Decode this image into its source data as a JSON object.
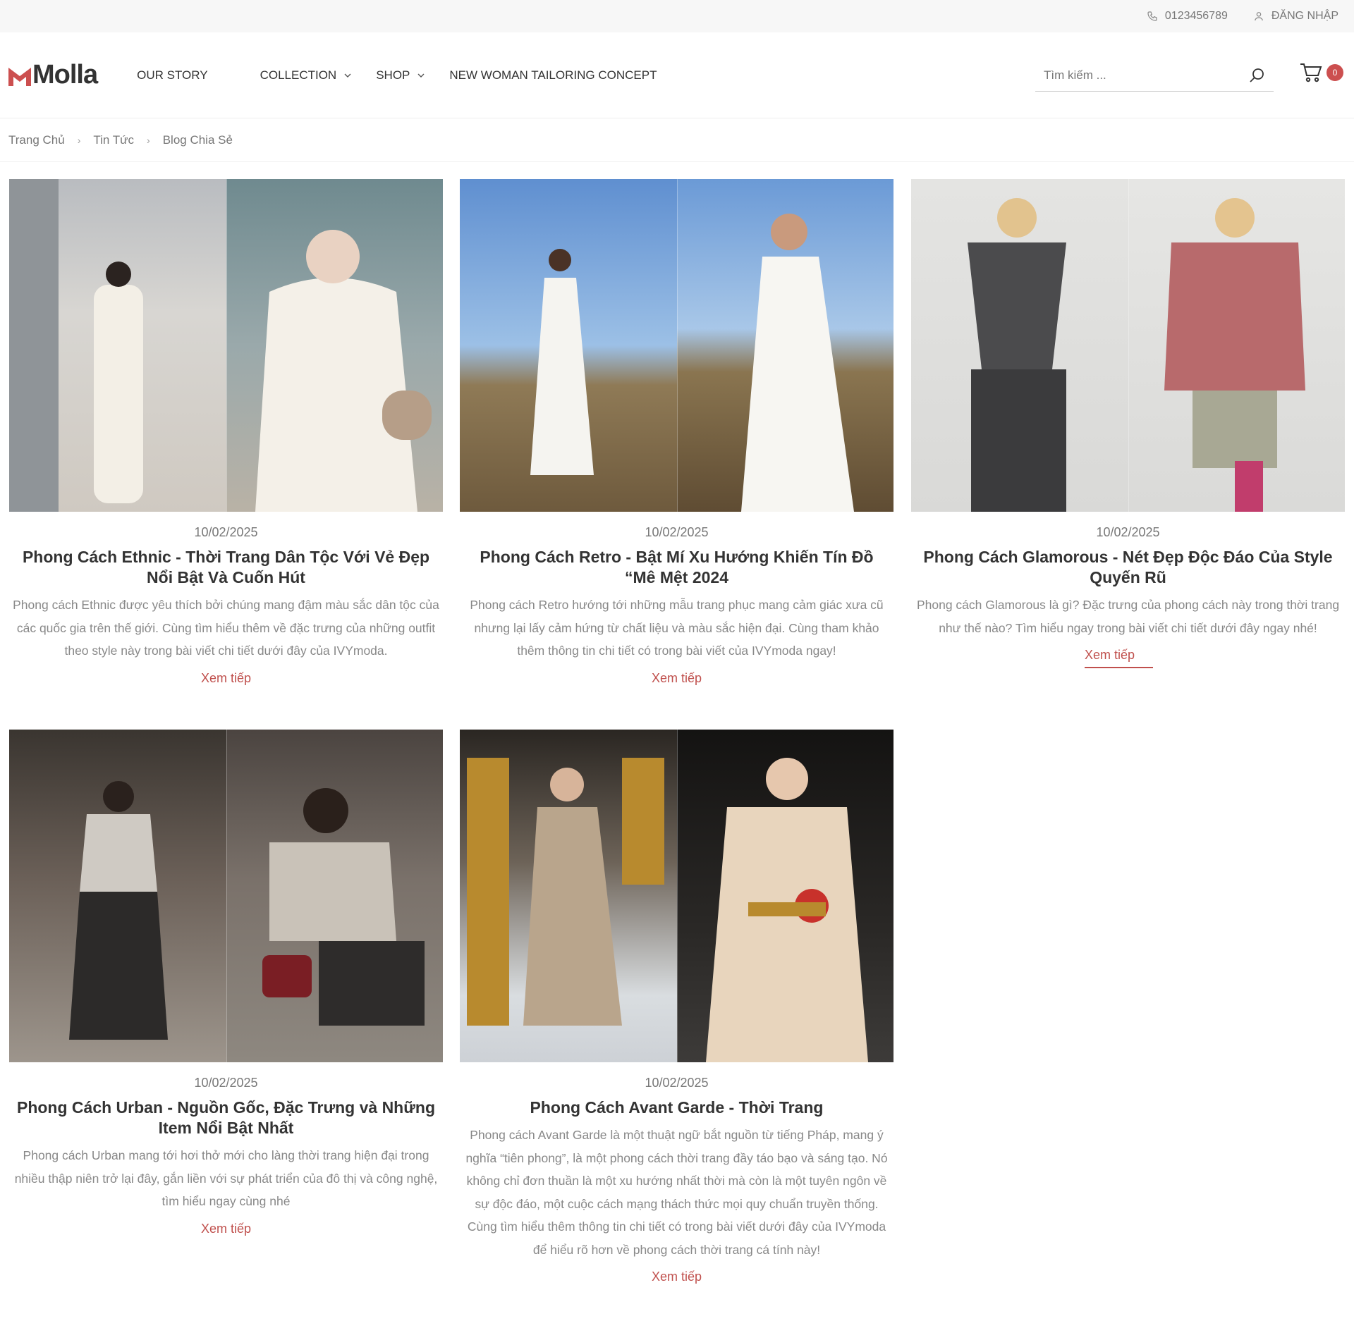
{
  "topbar": {
    "phone": "0123456789",
    "login": "ĐĂNG NHẬP",
    "phone_icon": "phone-icon",
    "user_icon": "user-icon"
  },
  "header": {
    "logo_text": "Molla",
    "nav": [
      {
        "label": "OUR STORY",
        "dropdown": false
      },
      {
        "label": "COLLECTION",
        "dropdown": true
      },
      {
        "label": "SHOP",
        "dropdown": true
      },
      {
        "label": "NEW WOMAN TAILORING CONCEPT",
        "dropdown": false
      }
    ],
    "search_placeholder": "Tìm kiếm ...",
    "cart_count": "0"
  },
  "breadcrumb": [
    "Trang Chủ",
    "Tin Tức",
    "Blog Chia Sẻ"
  ],
  "colors": {
    "accent": "#c0504d",
    "badge": "#cc4f4f",
    "text": "#333333",
    "muted": "#888888"
  },
  "posts": [
    {
      "date": "10/02/2025",
      "title": "Phong Cách Ethnic - Thời Trang Dân Tộc Với Vẻ Đẹp Nổi Bật Và Cuốn Hút",
      "excerpt": "Phong cách Ethnic được yêu thích bởi chúng mang đậm màu sắc dân tộc của các quốc gia trên thế giới. Cùng tìm hiểu thêm về đặc trưng của những outfit theo style này trong bài viết chi tiết dưới đây của IVYmoda.",
      "more": "Xem tiếp"
    },
    {
      "date": "10/02/2025",
      "title": "Phong Cách Retro - Bật Mí Xu Hướng Khiến Tín Đồ “Mê Mệt 2024",
      "excerpt": "Phong cách Retro hướng tới những mẫu trang phục mang cảm giác xưa cũ nhưng lại lấy cảm hứng từ chất liệu và màu sắc hiện đại. Cùng tham khảo thêm thông tin chi tiết có trong bài viết của IVYmoda ngay!",
      "more": "Xem tiếp"
    },
    {
      "date": "10/02/2025",
      "title": "Phong Cách Glamorous - Nét Đẹp Độc Đáo Của Style Quyến Rũ",
      "excerpt": "Phong cách Glamorous là gì? Đặc trưng của phong cách này trong thời trang như thế nào? Tìm hiểu ngay trong bài viết chi tiết dưới đây ngay nhé!",
      "more": "Xem tiếp"
    },
    {
      "date": "10/02/2025",
      "title": "Phong Cách Urban - Nguồn Gốc, Đặc Trưng và Những Item Nổi Bật Nhất",
      "excerpt": "Phong cách Urban mang tới hơi thở mới cho làng thời trang hiện đại trong nhiều thập niên trở lại đây, gắn liền với sự phát triển của đô thị và công nghệ, tìm hiểu ngay cùng nhé",
      "more": "Xem tiếp"
    },
    {
      "date": "10/02/2025",
      "title": "Phong Cách Avant Garde - Thời Trang",
      "excerpt": "Phong cách Avant Garde là một thuật ngữ bắt nguồn từ tiếng Pháp, mang ý nghĩa “tiên phong”, là một phong cách thời trang đầy táo bạo và sáng tạo. Nó không chỉ đơn thuần là một xu hướng nhất thời mà còn là một tuyên ngôn về sự độc đáo, một cuộc cách mạng thách thức mọi quy chuẩn truyền thống. Cùng tìm hiểu thêm thông tin chi tiết có trong bài viết dưới đây của IVYmoda để hiểu rõ hơn về phong cách thời trang cá tính này!",
      "more": "Xem tiếp"
    }
  ]
}
